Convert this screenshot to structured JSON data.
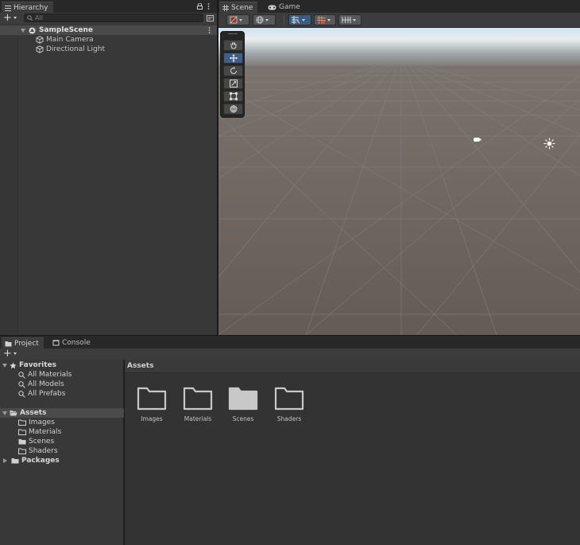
{
  "hierarchy": {
    "tab_label": "Hierarchy",
    "add_label": "+",
    "search_placeholder": "All",
    "scene_name": "SampleScene",
    "items": [
      {
        "label": "Main Camera",
        "icon": "gameobject-cube-icon"
      },
      {
        "label": "Directional Light",
        "icon": "gameobject-cube-icon"
      }
    ]
  },
  "scene_view": {
    "tabs": [
      {
        "label": "Scene",
        "icon": "grid-icon",
        "active": true
      },
      {
        "label": "Game",
        "icon": "gamepad-icon",
        "active": false
      }
    ],
    "toolbar_icons": [
      "shading-mode-icon",
      "globe-icon",
      "snap-icon",
      "gizmos-icon",
      "grid-toggle-icon"
    ],
    "tools": [
      "hand-tool-icon",
      "move-tool-icon",
      "rotate-tool-icon",
      "scale-tool-icon",
      "rect-tool-icon",
      "transform-tool-icon"
    ],
    "colors": {
      "sky": "#bcd4e8",
      "ground": "#6a625b",
      "accent": "#3d5a80"
    }
  },
  "bottom": {
    "tabs": [
      {
        "label": "Project",
        "icon": "folder-icon",
        "active": true
      },
      {
        "label": "Console",
        "icon": "console-icon",
        "active": false
      }
    ],
    "add_label": "+"
  },
  "project_tree": {
    "favorites_label": "Favorites",
    "favorites": [
      "All Materials",
      "All Models",
      "All Prefabs"
    ],
    "assets_label": "Assets",
    "asset_folders": [
      "Images",
      "Materials",
      "Scenes",
      "Shaders"
    ],
    "packages_label": "Packages"
  },
  "project_main": {
    "header": "Assets",
    "items": [
      "Images",
      "Materials",
      "Scenes",
      "Shaders"
    ]
  }
}
